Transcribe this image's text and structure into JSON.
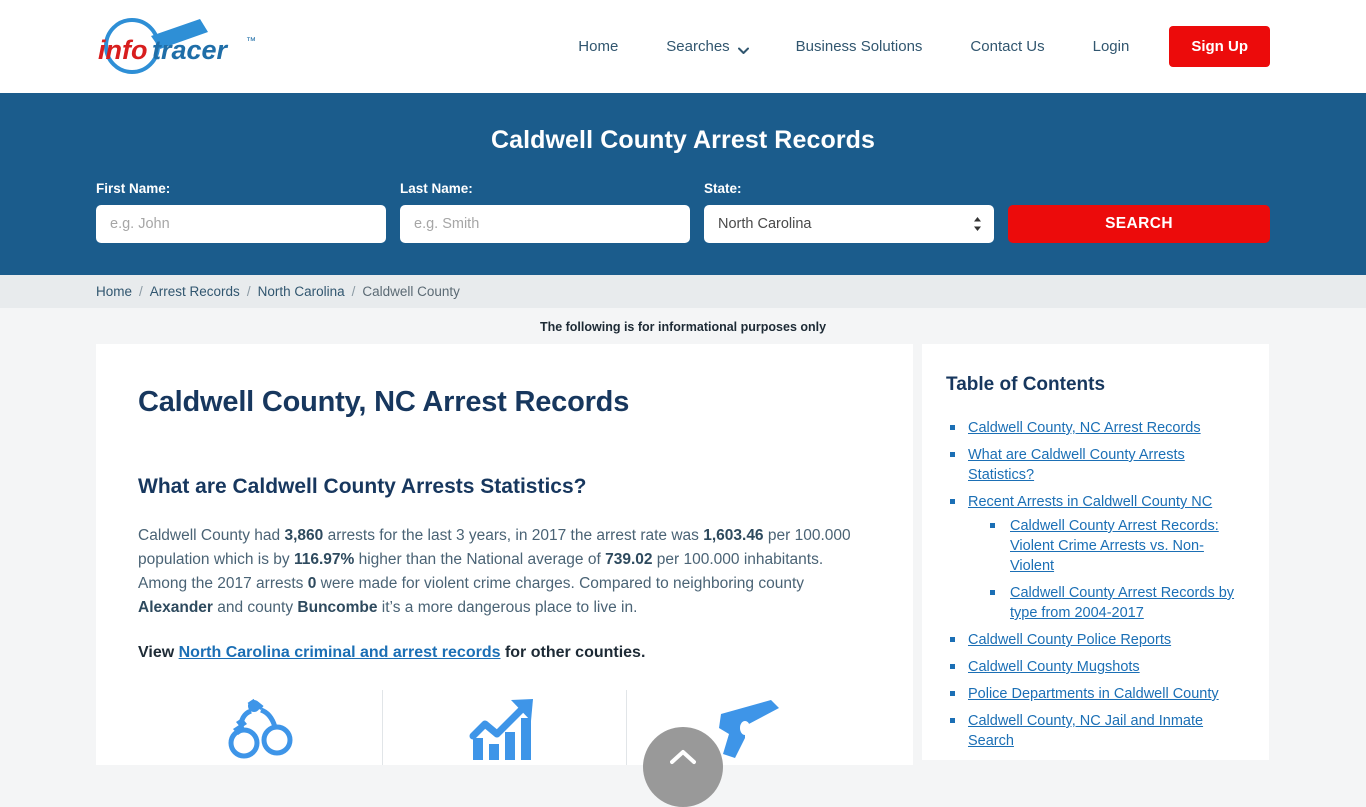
{
  "header": {
    "logo_text_left": "info",
    "logo_text_right": "tracer",
    "logo_tm": "™",
    "nav": [
      {
        "label": "Home",
        "has_caret": false
      },
      {
        "label": "Searches",
        "has_caret": true
      },
      {
        "label": "Business Solutions",
        "has_caret": false
      },
      {
        "label": "Contact Us",
        "has_caret": false
      },
      {
        "label": "Login",
        "has_caret": false
      }
    ],
    "signup_label": "Sign Up",
    "signup_color": "#ec0b0b"
  },
  "search_band": {
    "title": "Caldwell County Arrest Records",
    "background": "#1b5c8c",
    "first_name_label": "First Name:",
    "first_name_placeholder": "e.g. John",
    "first_name_value": "",
    "last_name_label": "Last Name:",
    "last_name_placeholder": "e.g. Smith",
    "last_name_value": "",
    "state_label": "State:",
    "state_value": "North Carolina",
    "state_options": [
      "North Carolina"
    ],
    "search_label": "SEARCH"
  },
  "breadcrumb": {
    "items": [
      "Home",
      "Arrest Records",
      "North Carolina",
      "Caldwell County"
    ],
    "separator": "/"
  },
  "disclaimer": "The following is for informational purposes only",
  "main": {
    "page_title": "Caldwell County, NC Arrest Records",
    "section_title": "What are Caldwell County Arrests Statistics?",
    "paragraph": {
      "p1": "Caldwell County had ",
      "stat_arrests": "3,860",
      "p2": " arrests for the last 3 years, in 2017 the arrest rate was ",
      "stat_rate": "1,603.46",
      "p3": " per 100.000 population which is by ",
      "stat_percent": "116.97%",
      "p4": " higher than the National average of ",
      "stat_national": "739.02",
      "p5": " per 100.000 inhabitants. Among the 2017 arrests ",
      "stat_violent": "0",
      "p6": " were made for violent crime charges. Compared to neighboring county ",
      "county_a": "Alexander",
      "p7": " and county ",
      "county_b": "Buncombe",
      "p8": " it’s a more dangerous place to live in."
    },
    "cta": {
      "prefix": "View ",
      "link": "North Carolina criminal and arrest records",
      "suffix": " for other counties."
    },
    "icons": [
      "handcuffs-icon",
      "growth-chart-icon",
      "handgun-icon"
    ],
    "icon_color": "#3e95e8"
  },
  "toc": {
    "title": "Table of Contents",
    "items": [
      {
        "label": "Caldwell County, NC Arrest Records",
        "children": []
      },
      {
        "label": "What are Caldwell County Arrests Statistics?",
        "children": []
      },
      {
        "label": "Recent Arrests in Caldwell County NC",
        "children": [
          {
            "label": "Caldwell County Arrest Records: Violent Crime Arrests vs. Non-Violent"
          },
          {
            "label": "Caldwell County Arrest Records by type from 2004-2017"
          }
        ]
      },
      {
        "label": "Caldwell County Police Reports",
        "children": []
      },
      {
        "label": "Caldwell County Mugshots",
        "children": []
      },
      {
        "label": "Police Departments in Caldwell County",
        "children": []
      },
      {
        "label": "Caldwell County, NC Jail and Inmate Search",
        "children": []
      }
    ],
    "link_color": "#1b6fb5"
  },
  "scroll_top": {
    "name": "scroll-to-top",
    "color": "#999999"
  }
}
